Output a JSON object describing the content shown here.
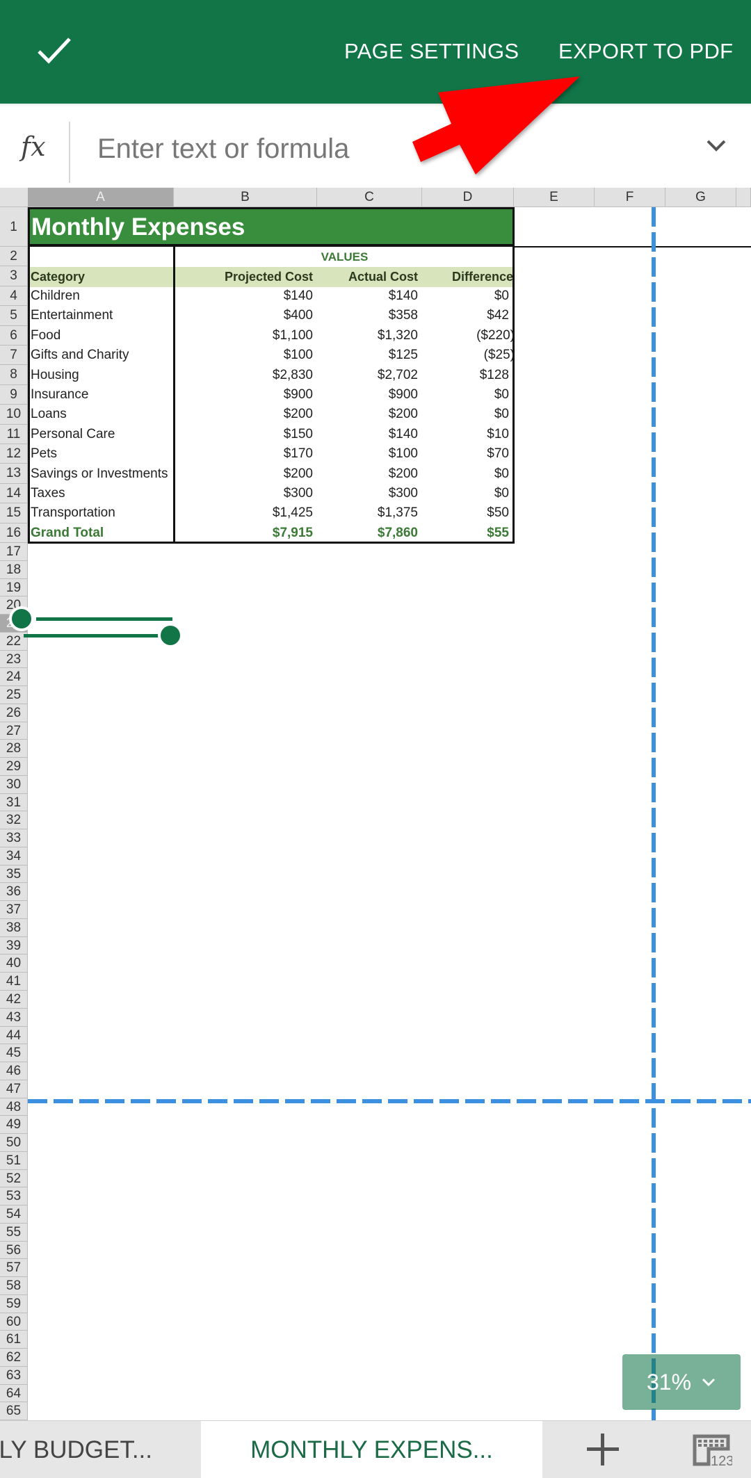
{
  "appbar": {
    "done_icon": "check-icon",
    "page_settings_label": "PAGE SETTINGS",
    "export_pdf_label": "EXPORT TO PDF"
  },
  "formula_bar": {
    "fx_label": "fx",
    "placeholder": "Enter text or formula",
    "value": "",
    "expand_icon": "chevron-down-icon"
  },
  "columns": [
    "A",
    "B",
    "C",
    "D",
    "E",
    "F",
    "G"
  ],
  "selected_column": "A",
  "selected_row": 21,
  "rows_visible": {
    "first": 1,
    "last": 65
  },
  "sheet": {
    "title": "Monthly Expenses",
    "values_header": "VALUES",
    "headers": [
      "Category",
      "Projected Cost",
      "Actual Cost",
      "Difference"
    ],
    "rows": [
      {
        "category": "Children",
        "projected": "$140",
        "actual": "$140",
        "difference": "$0"
      },
      {
        "category": "Entertainment",
        "projected": "$400",
        "actual": "$358",
        "difference": "$42"
      },
      {
        "category": "Food",
        "projected": "$1,100",
        "actual": "$1,320",
        "difference": "($220)"
      },
      {
        "category": "Gifts and Charity",
        "projected": "$100",
        "actual": "$125",
        "difference": "($25)"
      },
      {
        "category": "Housing",
        "projected": "$2,830",
        "actual": "$2,702",
        "difference": "$128"
      },
      {
        "category": "Insurance",
        "projected": "$900",
        "actual": "$900",
        "difference": "$0"
      },
      {
        "category": "Loans",
        "projected": "$200",
        "actual": "$200",
        "difference": "$0"
      },
      {
        "category": "Personal Care",
        "projected": "$150",
        "actual": "$140",
        "difference": "$10"
      },
      {
        "category": "Pets",
        "projected": "$170",
        "actual": "$100",
        "difference": "$70"
      },
      {
        "category": "Savings or Investments",
        "projected": "$200",
        "actual": "$200",
        "difference": "$0"
      },
      {
        "category": "Taxes",
        "projected": "$300",
        "actual": "$300",
        "difference": "$0"
      },
      {
        "category": "Transportation",
        "projected": "$1,425",
        "actual": "$1,375",
        "difference": "$50"
      }
    ],
    "total": {
      "category": "Grand Total",
      "projected": "$7,915",
      "actual": "$7,860",
      "difference": "$55"
    }
  },
  "zoom": {
    "label": "31%",
    "icon": "chevron-down-icon"
  },
  "tabs": [
    {
      "label": "LY BUDGET...",
      "active": false
    },
    {
      "label": "MONTHLY EXPENS...",
      "active": true
    }
  ],
  "bottom_actions": {
    "add_icon": "plus-icon",
    "keyboard_icon": "numeric-keyboard-icon",
    "keyboard_label": "123"
  },
  "colors": {
    "appbar": "#117548",
    "title_fill": "#388e3c",
    "header_band": "#d8e4bc",
    "total_text": "#3b7a35",
    "page_break": "#3d8fe0",
    "annotation_arrow": "#ff0000"
  }
}
